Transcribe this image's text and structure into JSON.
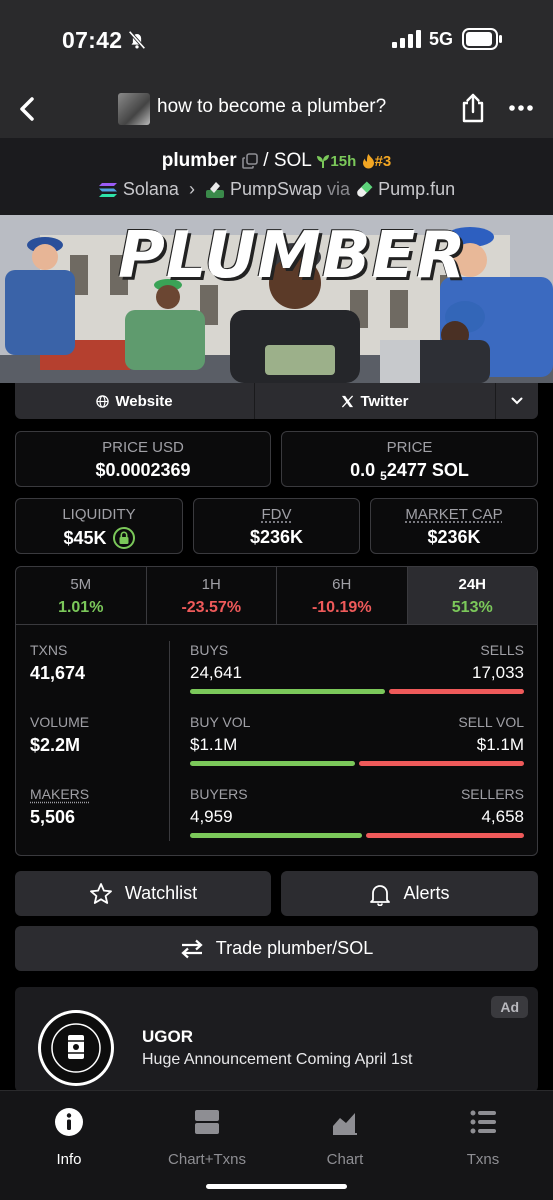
{
  "status_bar": {
    "time": "07:42",
    "network": "5G"
  },
  "nav": {
    "title": "how to become a plumber?"
  },
  "token": {
    "symbol": "plumber",
    "separator": "/",
    "quote": "SOL",
    "age": "15h",
    "rank": "#3",
    "chain": "Solana",
    "dex": "PumpSwap",
    "via": "via",
    "launchpad": "Pump.fun"
  },
  "banner": {
    "title": "PLUMBER"
  },
  "links": {
    "website": "Website",
    "twitter": "Twitter"
  },
  "price_usd": {
    "label": "PRICE USD",
    "value": "$0.0002369"
  },
  "price": {
    "label": "PRICE",
    "prefix": "0.0",
    "sub": "5",
    "suffix": "2477 SOL"
  },
  "liquidity": {
    "label": "LIQUIDITY",
    "value": "$45K"
  },
  "fdv": {
    "label": "FDV",
    "value": "$236K"
  },
  "market_cap": {
    "label": "MARKET CAP",
    "value": "$236K"
  },
  "timeframes": [
    {
      "label": "5M",
      "change": "1.01%"
    },
    {
      "label": "1H",
      "change": "-23.57%"
    },
    {
      "label": "6H",
      "change": "-10.19%"
    },
    {
      "label": "24H",
      "change": "513%"
    }
  ],
  "stats": {
    "txns": {
      "label": "TXNS",
      "value": "41,674"
    },
    "volume": {
      "label": "VOLUME",
      "value": "$2.2M"
    },
    "makers": {
      "label": "MAKERS",
      "value": "5,506"
    },
    "buys": {
      "label": "BUYS",
      "value": "24,641"
    },
    "sells": {
      "label": "SELLS",
      "value": "17,033"
    },
    "buy_vol": {
      "label": "BUY VOL",
      "value": "$1.1M"
    },
    "sell_vol": {
      "label": "SELL VOL",
      "value": "$1.1M"
    },
    "buyers": {
      "label": "BUYERS",
      "value": "4,959"
    },
    "sellers": {
      "label": "SELLERS",
      "value": "4,658"
    },
    "buys_ratio": 0.59,
    "buy_vol_ratio": 0.5,
    "buyers_ratio": 0.52
  },
  "buttons": {
    "watchlist": "Watchlist",
    "alerts": "Alerts",
    "trade": "Trade plumber/SOL"
  },
  "ad": {
    "name": "UGOR",
    "description": "Huge Announcement Coming April 1st",
    "tag": "Ad"
  },
  "tabs": [
    {
      "label": "Info"
    },
    {
      "label": "Chart+Txns"
    },
    {
      "label": "Chart"
    },
    {
      "label": "Txns"
    }
  ],
  "colors": {
    "positive": "#7bc85a",
    "negative": "#ef5a5a",
    "rank": "#f2a623"
  }
}
